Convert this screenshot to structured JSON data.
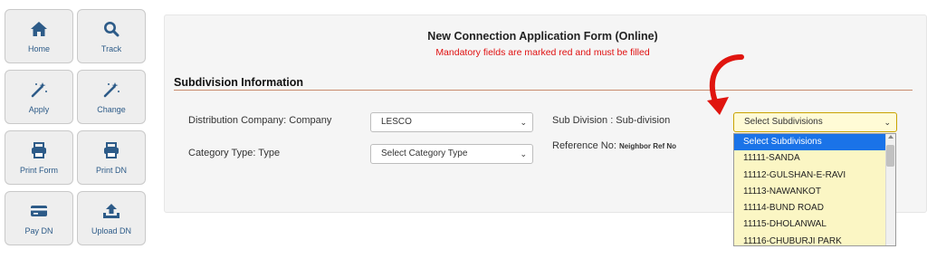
{
  "sidebar": {
    "items": [
      {
        "label": "Home"
      },
      {
        "label": "Track"
      },
      {
        "label": "Apply"
      },
      {
        "label": "Change"
      },
      {
        "label": "Print Form"
      },
      {
        "label": "Print DN"
      },
      {
        "label": "Pay DN"
      },
      {
        "label": "Upload DN"
      }
    ]
  },
  "form": {
    "title": "New Connection Application Form (Online)",
    "subtitle": "Mandatory fields are marked red and must be filled",
    "section_title": "Subdivision Information",
    "distribution_label": "Distribution Company: Company",
    "distribution_value": "LESCO",
    "category_label": "Category Type:   Type",
    "category_value": "Select Category Type",
    "subdivision_label": "Sub Division : Sub-division",
    "subdivision_value": "Select Subdivisions",
    "reference_label": "Reference No:",
    "reference_hint": "Neighbor Ref No"
  },
  "dropdown": {
    "options": [
      "Select Subdivisions",
      "11111-SANDA",
      "11112-GULSHAN-E-RAVI",
      "11113-NAWANKOT",
      "11114-BUND ROAD",
      "11115-DHOLANWAL",
      "11116-CHUBURJI PARK"
    ],
    "selected_index": 0
  },
  "colors": {
    "accent_blue": "#2d5b88",
    "required_red": "#e01010",
    "highlight_blue": "#1a73e8",
    "dropdown_bg": "#fbf6c4",
    "arrow_red": "#e0150f"
  }
}
